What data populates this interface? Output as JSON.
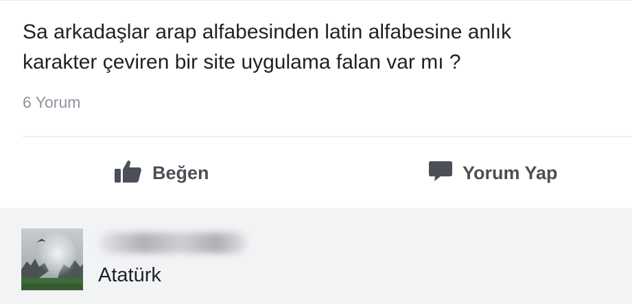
{
  "post": {
    "text_lines": [
      "Sa arkadaşlar arap alfabesinden latin alfabesine anlık",
      "karakter çeviren bir site uygulama falan var mı ?"
    ],
    "comment_count": "6 Yorum"
  },
  "actions": {
    "like_label": "Beğen",
    "comment_label": "Yorum Yap"
  },
  "comment": {
    "text": "Atatürk"
  },
  "icons": {
    "like": "thumbs-up-icon",
    "comment": "speech-bubble-icon"
  },
  "colors": {
    "text_primary": "#1d2129",
    "text_secondary": "#8d949e",
    "action_text": "#4b4f56",
    "comment_background": "#f2f3f5"
  }
}
